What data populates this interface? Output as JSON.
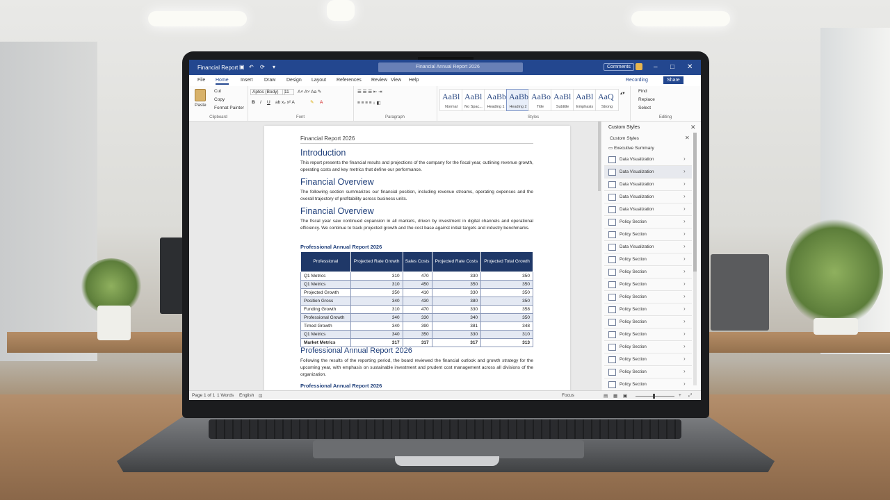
{
  "titlebar": {
    "app_name": "Financial Report",
    "search_text": "Financial Annual Report 2026",
    "comments_label": "Comments"
  },
  "ribbon_tabs": [
    "File",
    "Home",
    "Insert",
    "Draw",
    "Design",
    "Layout",
    "References",
    "Review",
    "View",
    "Help"
  ],
  "active_tab_index": 1,
  "ribbon_right": {
    "record": "Recording",
    "share": "Share"
  },
  "ribbon": {
    "clipboard": {
      "paste": "Paste",
      "cut": "Cut",
      "copy": "Copy",
      "format": "Format Painter",
      "label": "Clipboard"
    },
    "font": {
      "name": "Aptos (Body)",
      "size": "11",
      "label": "Font"
    },
    "paragraph": {
      "label": "Paragraph"
    },
    "styles": {
      "tiles": [
        {
          "preview": "AaBl",
          "name": "Normal"
        },
        {
          "preview": "AaBl",
          "name": "No Spac..."
        },
        {
          "preview": "AaBb",
          "name": "Heading 1"
        },
        {
          "preview": "AaBb",
          "name": "Heading 2"
        },
        {
          "preview": "AaBo",
          "name": "Title"
        },
        {
          "preview": "AaBl",
          "name": "Subtitle"
        },
        {
          "preview": "AaBl",
          "name": "Emphasis"
        },
        {
          "preview": "AaQ",
          "name": "Strong"
        }
      ],
      "label": "Styles"
    },
    "editing": {
      "find": "Find",
      "replace": "Replace",
      "select": "Select",
      "label": "Editing"
    }
  },
  "document": {
    "header": "Financial Report 2026",
    "sections": [
      {
        "heading": "Introduction",
        "text": "This report presents the financial results and projections of the company for the fiscal year, outlining revenue growth, operating costs and key metrics that define our performance."
      },
      {
        "heading": "Financial Overview",
        "text": "The following section summarizes our financial position, including revenue streams, operating expenses and the overall trajectory of profitability across business units."
      },
      {
        "heading": "Financial Overview",
        "text": "The fiscal year saw continued expansion in all markets, driven by investment in digital channels and operational efficiency. We continue to track projected growth and the cost base against initial targets and industry benchmarks."
      }
    ],
    "table": {
      "title": "Professional Annual Report 2026",
      "headers": [
        "Professional",
        "Projected Rate Growth",
        "Sales Costs",
        "Projected Rate Costs",
        "Projected Total Growth"
      ],
      "rows": [
        [
          "Q1 Metrics",
          "310",
          "470",
          "330",
          "350"
        ],
        [
          "Q1 Metrics",
          "310",
          "450",
          "350",
          "350"
        ],
        [
          "Projected Growth",
          "350",
          "410",
          "330",
          "350"
        ],
        [
          "Position Gross",
          "340",
          "430",
          "380",
          "350"
        ],
        [
          "Funding Growth",
          "310",
          "470",
          "330",
          "358"
        ],
        [
          "Professional Growth",
          "340",
          "330",
          "340",
          "350"
        ],
        [
          "Timed Growth",
          "340",
          "390",
          "381",
          "348"
        ],
        [
          "Q1 Metrics",
          "340",
          "350",
          "330",
          "310"
        ],
        [
          "Market Metrics",
          "317",
          "317",
          "317",
          "313"
        ]
      ]
    },
    "section_after": {
      "heading": "Professional Annual Report 2026",
      "text": "Following the results of the reporting period, the board reviewed the financial outlook and growth strategy for the upcoming year, with emphasis on sustainable investment and prudent cost management across all divisions of the organization."
    },
    "subheading_end": "Professional Annual Report 2026"
  },
  "pane": {
    "title": "Custom Styles",
    "subtitle": "Custom Styles",
    "exec": "Executive Summary",
    "items": [
      "Data Visualization",
      "Data Visualization",
      "Data Visualization",
      "Data Visualization",
      "Data Visualization",
      "Policy Section",
      "Policy Section",
      "Data Visualization",
      "Policy Section",
      "Policy Section",
      "Policy Section",
      "Policy Section",
      "Policy Section",
      "Policy Section",
      "Policy Section",
      "Policy Section",
      "Policy Section",
      "Policy Section",
      "Policy Section"
    ],
    "highlighted_index": 1
  },
  "statusbar": {
    "page": "Page 1 of 1",
    "words": "1 Words",
    "lang": "English",
    "focus": "Focus",
    "zoom_fraction": 0.45
  }
}
